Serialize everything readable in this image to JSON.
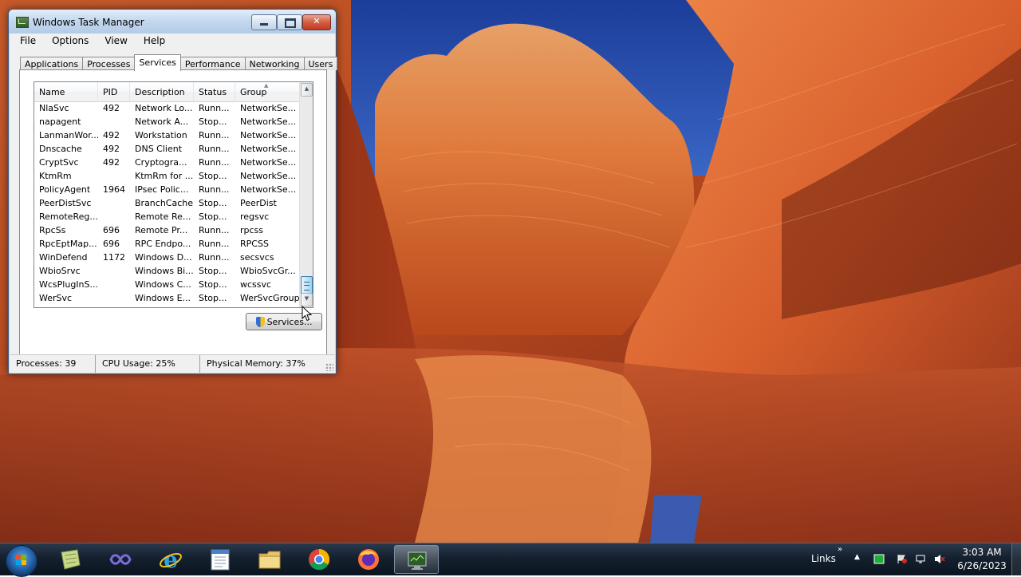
{
  "window": {
    "title": "Windows Task Manager",
    "controls": {
      "minimize": "minimize",
      "maximize": "maximize",
      "close": "✕"
    }
  },
  "menu": [
    "File",
    "Options",
    "View",
    "Help"
  ],
  "tabs": [
    "Applications",
    "Processes",
    "Services",
    "Performance",
    "Networking",
    "Users"
  ],
  "active_tab": "Services",
  "table": {
    "columns": [
      "Name",
      "PID",
      "Description",
      "Status",
      "Group"
    ],
    "sorted_column": "Group",
    "rows": [
      [
        "NlaSvc",
        "492",
        "Network Lo...",
        "Runn...",
        "NetworkSe..."
      ],
      [
        "napagent",
        "",
        "Network A...",
        "Stop...",
        "NetworkSe..."
      ],
      [
        "LanmanWor...",
        "492",
        "Workstation",
        "Runn...",
        "NetworkSe..."
      ],
      [
        "Dnscache",
        "492",
        "DNS Client",
        "Runn...",
        "NetworkSe..."
      ],
      [
        "CryptSvc",
        "492",
        "Cryptogra...",
        "Runn...",
        "NetworkSe..."
      ],
      [
        "KtmRm",
        "",
        "KtmRm for ...",
        "Stop...",
        "NetworkSe..."
      ],
      [
        "PolicyAgent",
        "1964",
        "IPsec Polic...",
        "Runn...",
        "NetworkSe..."
      ],
      [
        "PeerDistSvc",
        "",
        "BranchCache",
        "Stop...",
        "PeerDist"
      ],
      [
        "RemoteReg...",
        "",
        "Remote Re...",
        "Stop...",
        "regsvc"
      ],
      [
        "RpcSs",
        "696",
        "Remote Pr...",
        "Runn...",
        "rpcss"
      ],
      [
        "RpcEptMap...",
        "696",
        "RPC Endpo...",
        "Runn...",
        "RPCSS"
      ],
      [
        "WinDefend",
        "1172",
        "Windows D...",
        "Runn...",
        "secsvcs"
      ],
      [
        "WbioSrvc",
        "",
        "Windows Bi...",
        "Stop...",
        "WbioSvcGr..."
      ],
      [
        "WcsPlugInS...",
        "",
        "Windows C...",
        "Stop...",
        "wcssvc"
      ],
      [
        "WerSvc",
        "",
        "Windows E...",
        "Stop...",
        "WerSvcGroup"
      ]
    ]
  },
  "services_button": "Services...",
  "status": {
    "processes": "Processes: 39",
    "cpu": "CPU Usage: 25%",
    "memory": "Physical Memory: 37%"
  },
  "taskbar": {
    "links": "Links",
    "time": "3:03 AM",
    "date": "6/26/2023",
    "pinned": [
      "notes-icon",
      "visual-studio-icon",
      "internet-explorer-icon",
      "notepad-icon",
      "file-explorer-icon",
      "chrome-icon",
      "firefox-icon",
      "task-manager-icon"
    ]
  },
  "colors": {
    "titlebar": "#c4d8ef",
    "close_button": "#c23b22",
    "taskbar": "#14202e"
  }
}
